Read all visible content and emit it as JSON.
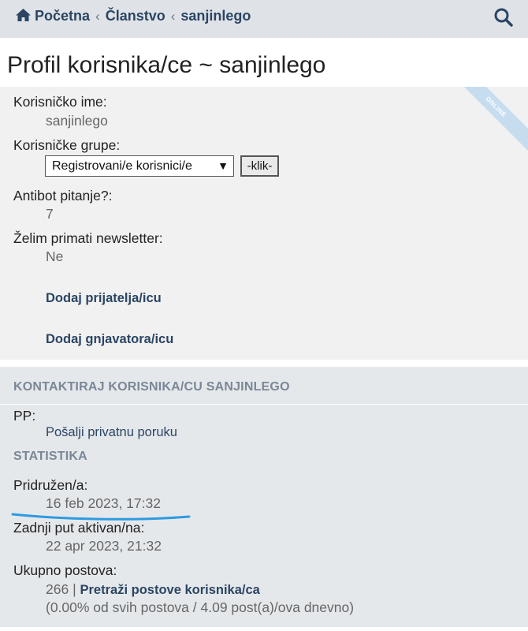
{
  "breadcrumb": {
    "home": "Početna",
    "membership": "Članstvo",
    "user": "sanjinlego"
  },
  "page_title": "Profil korisnika/ce ~ sanjinlego",
  "online_badge": "ONLINE",
  "profile": {
    "username_label": "Korisničko ime:",
    "username_value": "sanjinlego",
    "groups_label": "Korisničke grupe:",
    "groups_selected": "Registrovani/e korisnici/e",
    "groups_button": "-klik-",
    "antibot_label": "Antibot pitanje?:",
    "antibot_value": "7",
    "newsletter_label": "Želim primati newsletter:",
    "newsletter_value": "Ne",
    "add_friend": "Dodaj prijatelja/icu",
    "add_foe": "Dodaj gnjavatora/icu"
  },
  "contact": {
    "heading": "KONTAKTIRAJ KORISNIKA/CU SANJINLEGO",
    "pm_label": "PP:",
    "pm_link": "Pošalji privatnu poruku"
  },
  "stats": {
    "heading": "STATISTIKA",
    "joined_label": "Pridružen/a:",
    "joined_value": "16 feb 2023, 17:32",
    "last_active_label": "Zadnji put aktivan/na:",
    "last_active_value": "22 apr 2023, 21:32",
    "posts_label": "Ukupno postova:",
    "posts_count": "266",
    "posts_sep": "|",
    "posts_search_link": "Pretraži postove korisnika/ca",
    "posts_detail": "(0.00% od svih postova / 4.09 post(a)/ova dnevno)"
  },
  "colors": {
    "accent": "#2b4563",
    "annotation": "#2d9be0"
  }
}
